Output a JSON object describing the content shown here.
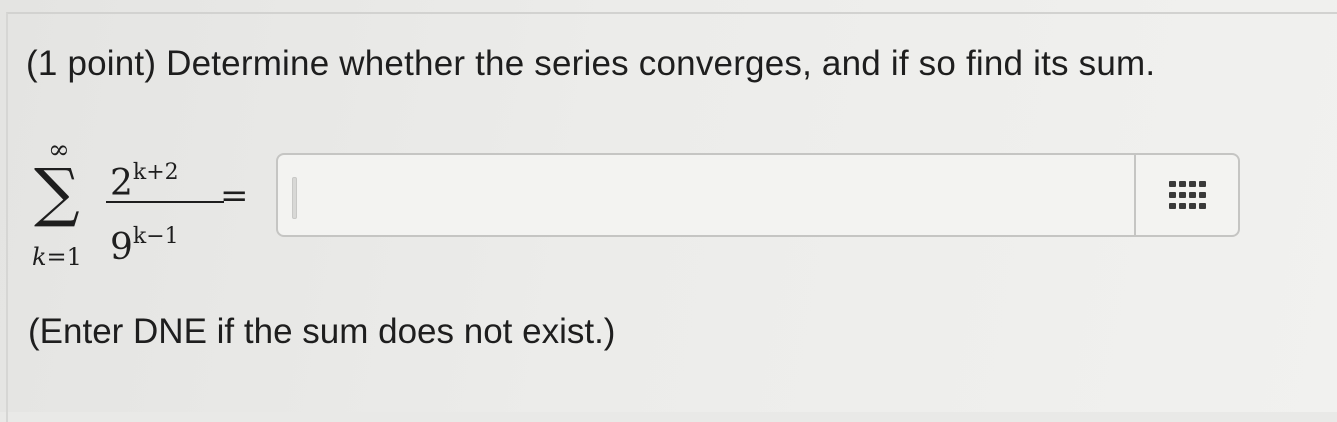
{
  "problem": {
    "prompt": "(1 point) Determine whether the series converges, and if so find its sum."
  },
  "expression": {
    "upper_limit": "∞",
    "lower_var": "k",
    "lower_eq": "=",
    "lower_value": "1",
    "numerator_base": "2",
    "numerator_exponent": "k+2",
    "denominator_base": "9",
    "denominator_exponent": "k−1",
    "equals": "="
  },
  "answer": {
    "value": "",
    "placeholder": ""
  },
  "icons": {
    "equation_palette": "grid-icon"
  },
  "hint": {
    "text": "(Enter DNE if the sum does not exist.)"
  }
}
